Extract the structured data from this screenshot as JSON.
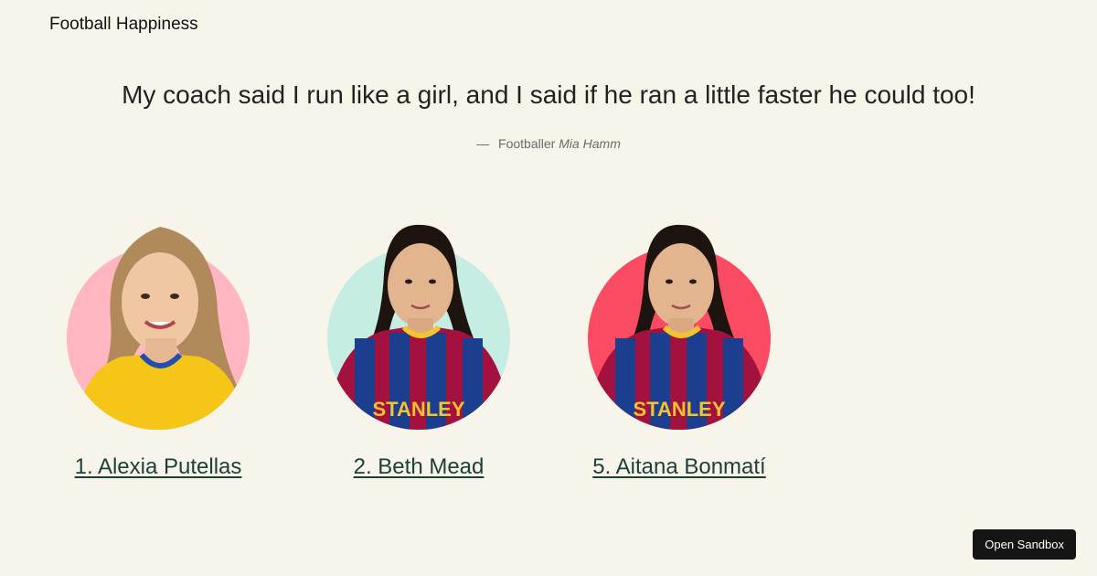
{
  "header": {
    "site_title": "Football Happiness"
  },
  "quote": {
    "text": "My coach said I run like a girl, and I said if he ran a little faster he could too!",
    "dash": "—",
    "role": "Footballer",
    "author": "Mia Hamm"
  },
  "players": [
    {
      "label": "1. Alexia Putellas",
      "bg_color": "#ffb6c1",
      "kit": "yellow"
    },
    {
      "label": "2. Beth Mead",
      "bg_color": "#c5ede4",
      "kit": "barcelona"
    },
    {
      "label": "5. Aitana Bonmatí",
      "bg_color": "#fb4b62",
      "kit": "barcelona"
    }
  ],
  "colors": {
    "page_bg": "#f7f4e9",
    "link": "#1d3f3a",
    "button_bg": "#151515"
  },
  "sandbox": {
    "label": "Open Sandbox"
  }
}
